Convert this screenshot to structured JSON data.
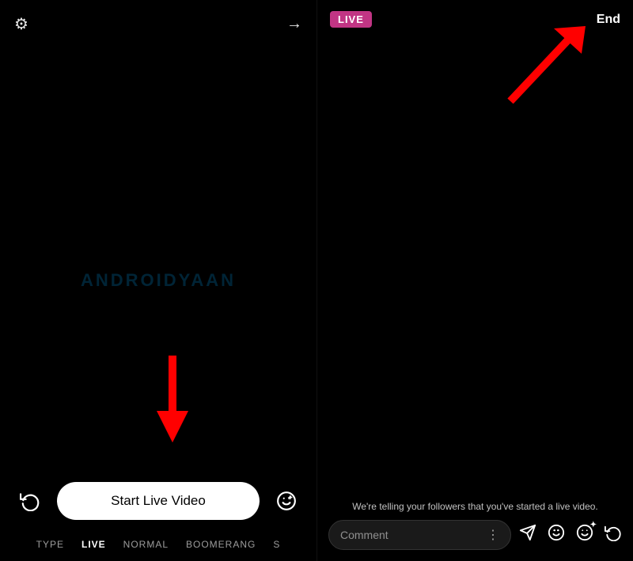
{
  "left": {
    "gear_label": "⚙",
    "arrow_right_label": "→",
    "watermark": "ANDROIDYAAN",
    "start_live_button": "Start Live Video",
    "tabs": [
      {
        "id": "type",
        "label": "TYPE",
        "active": false
      },
      {
        "id": "live",
        "label": "LIVE",
        "active": true
      },
      {
        "id": "normal",
        "label": "NORMAL",
        "active": false
      },
      {
        "id": "boomerang",
        "label": "BOOMERANG",
        "active": false
      },
      {
        "id": "s",
        "label": "S",
        "active": false
      }
    ],
    "icon_left": "↻",
    "icon_right": "☺"
  },
  "right": {
    "live_badge": "LIVE",
    "end_button": "End",
    "followers_text": "We're telling your followers that you've started a live video.",
    "comment_placeholder": "Comment",
    "icons": [
      "✈",
      "☺",
      "☺",
      "↻"
    ]
  }
}
